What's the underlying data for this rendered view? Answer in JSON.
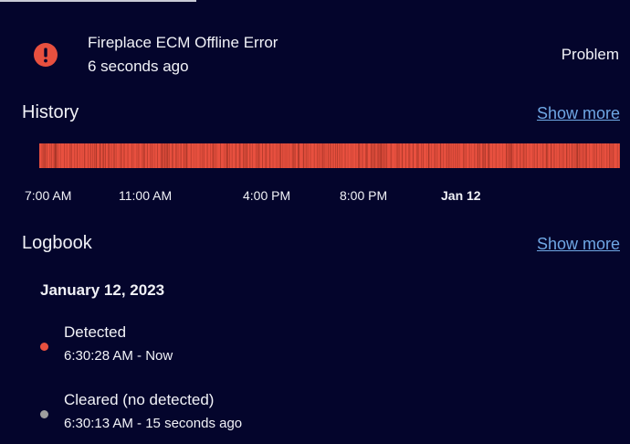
{
  "colors": {
    "background": "#04052c",
    "error": "#e8503f",
    "link": "#6fa7e4",
    "cleared_dot": "#9e9e9e"
  },
  "entity": {
    "icon": "alert-circle-icon",
    "name": "Fireplace ECM Offline Error",
    "last_changed": "6 seconds ago",
    "state": "Problem"
  },
  "history": {
    "title": "History",
    "show_more": "Show more",
    "ticks": [
      {
        "label": "7:00 AM",
        "bold": false
      },
      {
        "label": "11:00 AM",
        "bold": false
      },
      {
        "label": "4:00 PM",
        "bold": false
      },
      {
        "label": "8:00 PM",
        "bold": false
      },
      {
        "label": "Jan 12",
        "bold": true
      }
    ]
  },
  "logbook": {
    "title": "Logbook",
    "show_more": "Show more",
    "date": "January 12, 2023",
    "entries": [
      {
        "state": "Detected",
        "time": "6:30:28 AM - Now",
        "dot_color": "#e8503f"
      },
      {
        "state": "Cleared (no detected)",
        "time": "6:30:13 AM - 15 seconds ago",
        "dot_color": "#9e9e9e"
      }
    ]
  }
}
